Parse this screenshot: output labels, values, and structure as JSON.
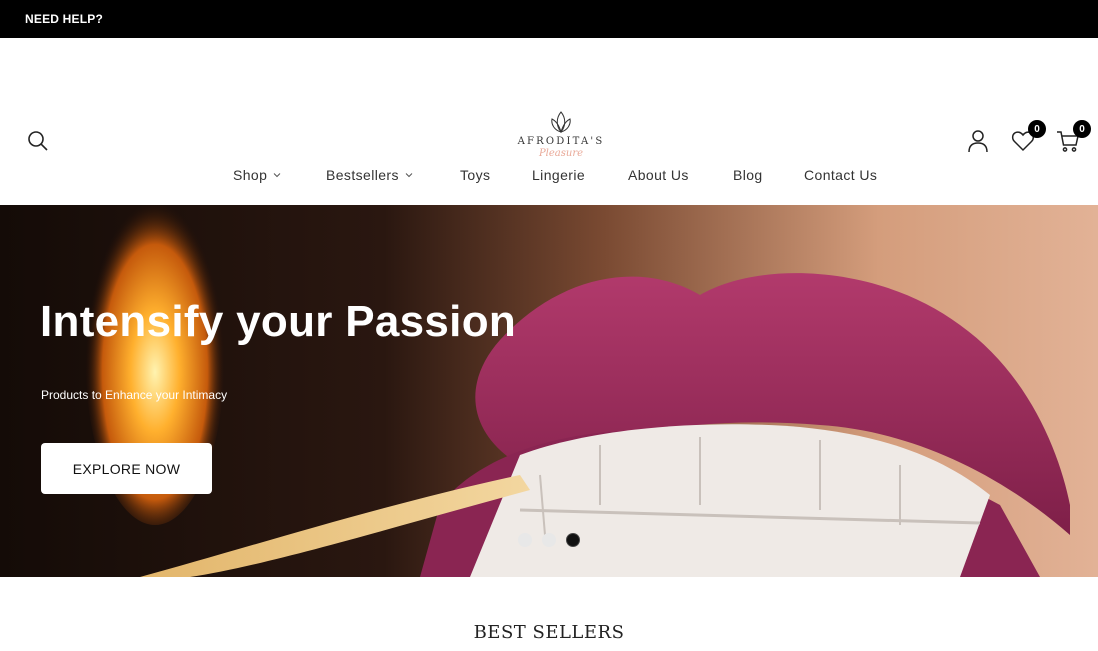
{
  "topbar": {
    "help_label": "NEED HELP?"
  },
  "header": {
    "logo": {
      "brand": "AFRODITA'S",
      "script": "Pleasure"
    },
    "wishlist": {
      "count": "0",
      "icon": "heart-icon"
    },
    "cart": {
      "count": "0",
      "icon": "cart-icon"
    },
    "account": {
      "icon": "user-icon"
    },
    "search": {
      "icon": "search-icon"
    }
  },
  "nav": {
    "items": [
      {
        "label": "Shop",
        "has_dropdown": true
      },
      {
        "label": "Bestsellers",
        "has_dropdown": true
      },
      {
        "label": "Toys",
        "has_dropdown": false
      },
      {
        "label": "Lingerie",
        "has_dropdown": false
      },
      {
        "label": "About Us",
        "has_dropdown": false
      },
      {
        "label": "Blog",
        "has_dropdown": false
      },
      {
        "label": "Contact Us",
        "has_dropdown": false
      }
    ]
  },
  "hero": {
    "title": "Intensify your Passion",
    "subtitle": "Products to Enhance your Intimacy",
    "cta_label": "EXPLORE NOW",
    "slides": 3,
    "active_slide": 3
  },
  "sections": {
    "best_sellers_title": "BEST SELLERS"
  },
  "colors": {
    "topbar": "#000000",
    "lip": "#9e2a5c",
    "badge": "#000000",
    "accent_script": "#e9a998"
  }
}
